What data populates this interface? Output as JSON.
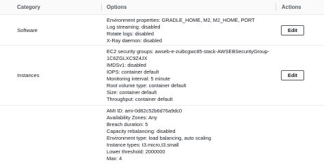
{
  "table": {
    "headers": {
      "category": "Category",
      "options": "Options",
      "actions": "Actions"
    },
    "rows": [
      {
        "category": "Software",
        "options": [
          "Environment properties: GRADLE_HOME, M2, M2_HOME, PORT",
          "Log streaming: disabled",
          "Rotate logs: disabled",
          "X-Ray daemon: disabled"
        ],
        "action_label": "Edit"
      },
      {
        "category": "Instances",
        "options": [
          "EC2 security groups: awseb-e-zuibcgwc85-stack-AWSEBSecurityGroup-",
          "1C6ZGLXC9Z4JX",
          "IMDSv1: disabled",
          "IOPS: container default",
          "Monitoring interval: 5 minute",
          "Root volume type: container default",
          "Size: container default",
          "Throughput: container default"
        ],
        "action_label": "Edit"
      },
      {
        "category": "",
        "options": [
          "AMI ID: ami-0d82c52b6d76a9dc0",
          "Availability Zones: Any",
          "Breach duration: 5",
          "Capacity rebalancing: disabled",
          "Environment type: load balancing, auto scaling",
          "Instance types: t3.micro,t3.small",
          "Lower threshold: 2000000",
          "Max: 4"
        ],
        "action_label": ""
      }
    ]
  }
}
